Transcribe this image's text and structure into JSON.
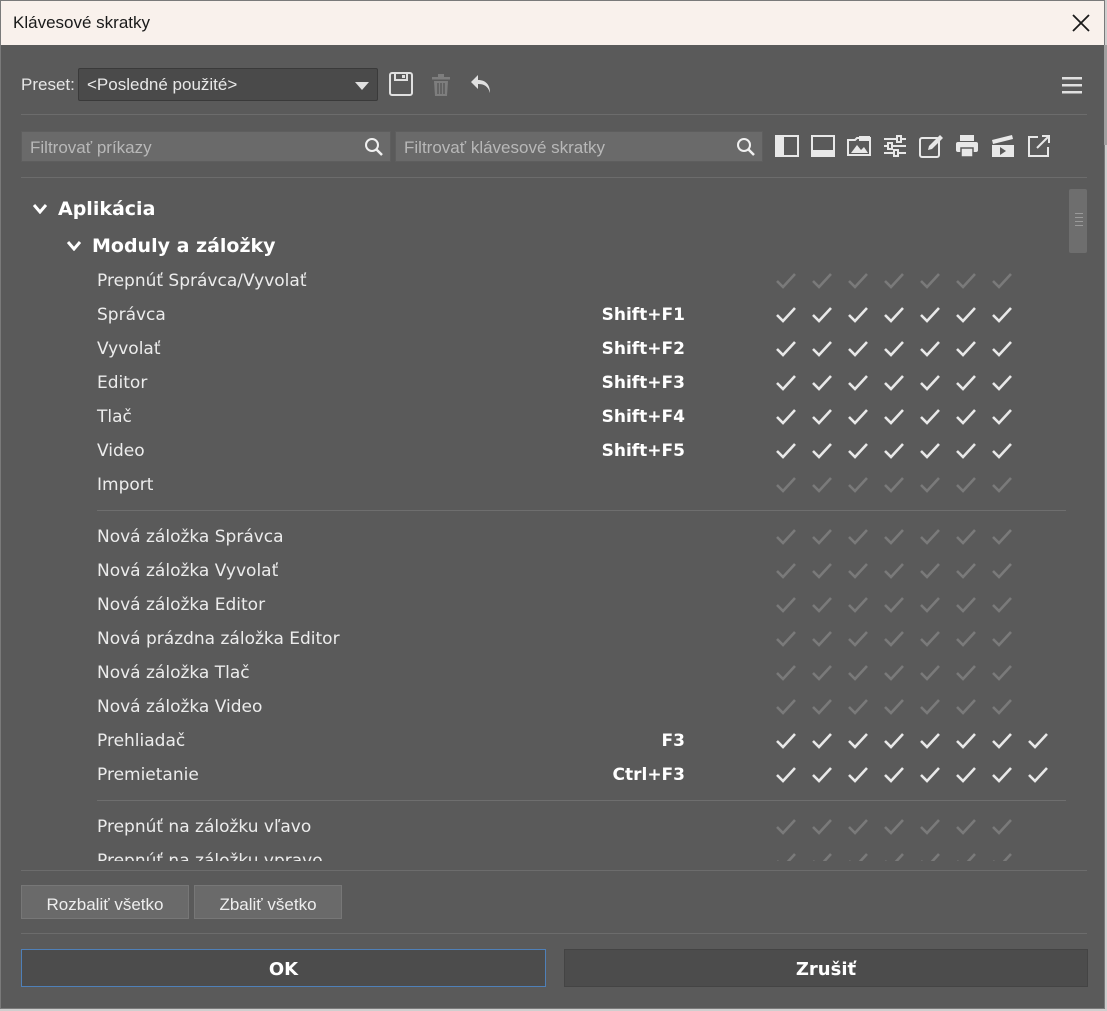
{
  "window": {
    "title": "Klávesové skratky"
  },
  "toolbar": {
    "preset_label": "Preset:",
    "preset_value": "<Posledné použité>"
  },
  "filters": {
    "commands_placeholder": "Filtrovať príkazy",
    "shortcuts_placeholder": "Filtrovať klávesové skratky"
  },
  "tree": {
    "group": "Aplikácia",
    "subgroup": "Moduly a záložky",
    "rows": [
      {
        "name": "Prepnúť Správca/Vyvolať",
        "key": "",
        "checks": 7,
        "active": false
      },
      {
        "name": "Správca",
        "key": "Shift+F1",
        "checks": 7,
        "active": true
      },
      {
        "name": "Vyvolať",
        "key": "Shift+F2",
        "checks": 7,
        "active": true
      },
      {
        "name": "Editor",
        "key": "Shift+F3",
        "checks": 7,
        "active": true
      },
      {
        "name": "Tlač",
        "key": "Shift+F4",
        "checks": 7,
        "active": true
      },
      {
        "name": "Video",
        "key": "Shift+F5",
        "checks": 7,
        "active": true
      },
      {
        "name": "Import",
        "key": "",
        "checks": 7,
        "active": false
      },
      {
        "name": "Nová záložka Správca",
        "key": "",
        "checks": 7,
        "active": false
      },
      {
        "name": "Nová záložka Vyvolať",
        "key": "",
        "checks": 7,
        "active": false
      },
      {
        "name": "Nová záložka Editor",
        "key": "",
        "checks": 7,
        "active": false
      },
      {
        "name": "Nová prázdna záložka Editor",
        "key": "",
        "checks": 7,
        "active": false
      },
      {
        "name": "Nová záložka Tlač",
        "key": "",
        "checks": 7,
        "active": false
      },
      {
        "name": "Nová záložka Video",
        "key": "",
        "checks": 7,
        "active": false
      },
      {
        "name": "Prehliadač",
        "key": "F3",
        "checks": 8,
        "active": true
      },
      {
        "name": "Premietanie",
        "key": "Ctrl+F3",
        "checks": 8,
        "active": true
      },
      {
        "name": "Prepnúť na záložku vľavo",
        "key": "",
        "checks": 7,
        "active": false
      },
      {
        "name": "Prepnúť na záložku vpravo",
        "key": "",
        "checks": 7,
        "active": false
      }
    ]
  },
  "buttons": {
    "expand_all": "Rozbaliť všetko",
    "collapse_all": "Zbaliť všetko",
    "ok": "OK",
    "cancel": "Zrušiť"
  },
  "colors": {
    "check_active": "#e8e8e8",
    "check_inactive": "#7a7a7a",
    "titlebar_bg": "#f9f1ec",
    "window_bg": "#5a5a5a"
  }
}
